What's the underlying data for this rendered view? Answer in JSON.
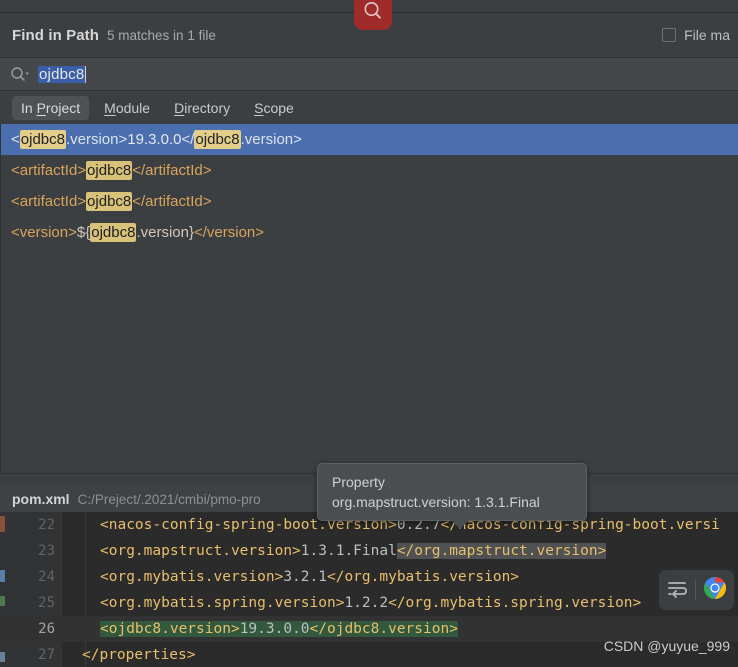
{
  "window": {
    "badge_icon": "search-icon"
  },
  "header": {
    "title": "Find in Path",
    "subtitle": "5 matches in 1 file",
    "file_mask_label": "File ma",
    "file_mask_checked": false
  },
  "search": {
    "icon": "search-dropdown-icon",
    "value": "ojdbc8",
    "selected": true
  },
  "scope_tabs": [
    {
      "pre": "In ",
      "mnemonic": "P",
      "post": "roject",
      "active": true
    },
    {
      "pre": "",
      "mnemonic": "M",
      "post": "odule",
      "active": false
    },
    {
      "pre": "",
      "mnemonic": "D",
      "post": "irectory",
      "active": false
    },
    {
      "pre": "",
      "mnemonic": "S",
      "post": "cope",
      "active": false
    }
  ],
  "results": [
    {
      "selected": true,
      "parts": [
        {
          "t": "tag",
          "s": "<"
        },
        {
          "t": "hl",
          "s": "ojdbc8"
        },
        {
          "t": "tag",
          "s": ".version>"
        },
        {
          "t": "plain",
          "s": "19.3.0.0"
        },
        {
          "t": "tag",
          "s": "</"
        },
        {
          "t": "hl",
          "s": "ojdbc8"
        },
        {
          "t": "tag",
          "s": ".version>"
        }
      ]
    },
    {
      "selected": false,
      "parts": [
        {
          "t": "tag",
          "s": "<artifactId>"
        },
        {
          "t": "hl",
          "s": "ojdbc8"
        },
        {
          "t": "tag",
          "s": "</artifactId>"
        }
      ]
    },
    {
      "selected": false,
      "parts": [
        {
          "t": "tag",
          "s": "<artifactId>"
        },
        {
          "t": "hl",
          "s": "ojdbc8"
        },
        {
          "t": "tag",
          "s": "</artifactId>"
        }
      ]
    },
    {
      "selected": false,
      "parts": [
        {
          "t": "tag",
          "s": "<version>"
        },
        {
          "t": "plain",
          "s": "${"
        },
        {
          "t": "hl",
          "s": "ojdbc8"
        },
        {
          "t": "plain",
          "s": ".version}"
        },
        {
          "t": "tag",
          "s": "</version>"
        }
      ]
    }
  ],
  "preview": {
    "file_name": "pom.xml",
    "file_path": "C:/Preject/.2021/cmbi/pmo-pro",
    "lines": [
      {
        "number": "22",
        "current": false,
        "indent": "deep",
        "parts": [
          {
            "t": "tag",
            "s": "<nacos-config-spring-boot.version>"
          },
          {
            "t": "val",
            "s": "0.2.7"
          },
          {
            "t": "tag",
            "s": "</nacos-config-spring-boot.versi"
          }
        ]
      },
      {
        "number": "23",
        "current": false,
        "indent": "deep",
        "parts": [
          {
            "t": "tag",
            "s": "<org.mapstruct.version>"
          },
          {
            "t": "val",
            "s": "1.3.1.Final"
          },
          {
            "t": "tag-grey",
            "s": "</org.mapstruct.version>"
          }
        ]
      },
      {
        "number": "24",
        "current": false,
        "indent": "deep",
        "parts": [
          {
            "t": "tag",
            "s": "<org.mybatis.version>"
          },
          {
            "t": "val",
            "s": "3.2.1"
          },
          {
            "t": "tag",
            "s": "</org.mybatis.version>"
          }
        ]
      },
      {
        "number": "25",
        "current": false,
        "indent": "deep",
        "parts": [
          {
            "t": "tag",
            "s": "<org.mybatis.spring.version>"
          },
          {
            "t": "val",
            "s": "1.2.2"
          },
          {
            "t": "tag",
            "s": "</org.mybatis.spring.version>"
          }
        ]
      },
      {
        "number": "26",
        "current": true,
        "indent": "deep",
        "parts": [
          {
            "t": "tag-green",
            "s": "<ojdbc8.version>"
          },
          {
            "t": "val-green",
            "s": "19.3.0.0"
          },
          {
            "t": "tag-green",
            "s": "</ojdbc8.version>"
          }
        ]
      },
      {
        "number": "27",
        "current": false,
        "indent": "shallow",
        "parts": [
          {
            "t": "tag",
            "s": "</properties>"
          }
        ]
      }
    ]
  },
  "tooltip": {
    "line1": "Property",
    "line2": "org.mapstruct.version: 1.3.1.Final"
  },
  "float_toolbar": {
    "wrap_icon": "soft-wrap-icon",
    "browser_icon": "chrome-icon"
  },
  "watermark": "CSDN @yuyue_999",
  "colors": {
    "dialog_bg": "#3c3f41",
    "selection_blue": "#4b6eaf",
    "match_highlight": "#d8c178",
    "badge_red": "#a02b2b",
    "editor_bg": "#2b2b2b",
    "tag_orange": "#e8bf6a",
    "green_match": "#32593d"
  }
}
